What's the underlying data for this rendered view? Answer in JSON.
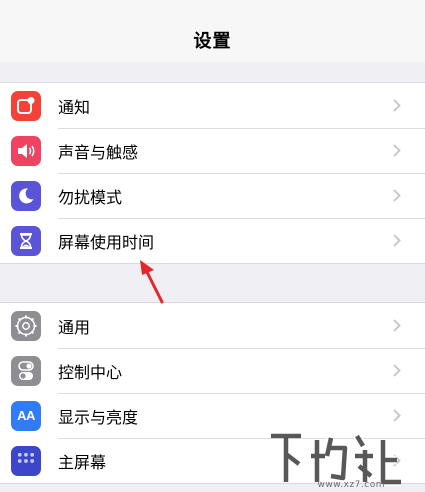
{
  "navbar": {
    "title": "设置"
  },
  "groups": [
    {
      "items": [
        {
          "label": "通知",
          "icon": "notifications-icon",
          "color": "#f44336"
        },
        {
          "label": "声音与触感",
          "icon": "sounds-icon",
          "color": "#ef4461"
        },
        {
          "label": "勿扰模式",
          "icon": "do-not-disturb-moon-icon",
          "color": "#5a55d6"
        },
        {
          "label": "屏幕使用时间",
          "icon": "screen-time-hourglass-icon",
          "color": "#5a55d6"
        }
      ]
    },
    {
      "items": [
        {
          "label": "通用",
          "icon": "general-gear-icon",
          "color": "#8e8e93"
        },
        {
          "label": "控制中心",
          "icon": "control-center-icon",
          "color": "#8e8e93"
        },
        {
          "label": "显示与亮度",
          "icon": "display-brightness-icon",
          "color": "#2f7cf6",
          "icon_text": "AA"
        },
        {
          "label": "主屏幕",
          "icon": "home-screen-icon",
          "color": "#3c46c8"
        }
      ]
    }
  ],
  "annotation": {
    "arrow_color": "#e5262b",
    "points_to": "屏幕使用时间"
  },
  "watermark": {
    "text": "www.xz7.com"
  }
}
